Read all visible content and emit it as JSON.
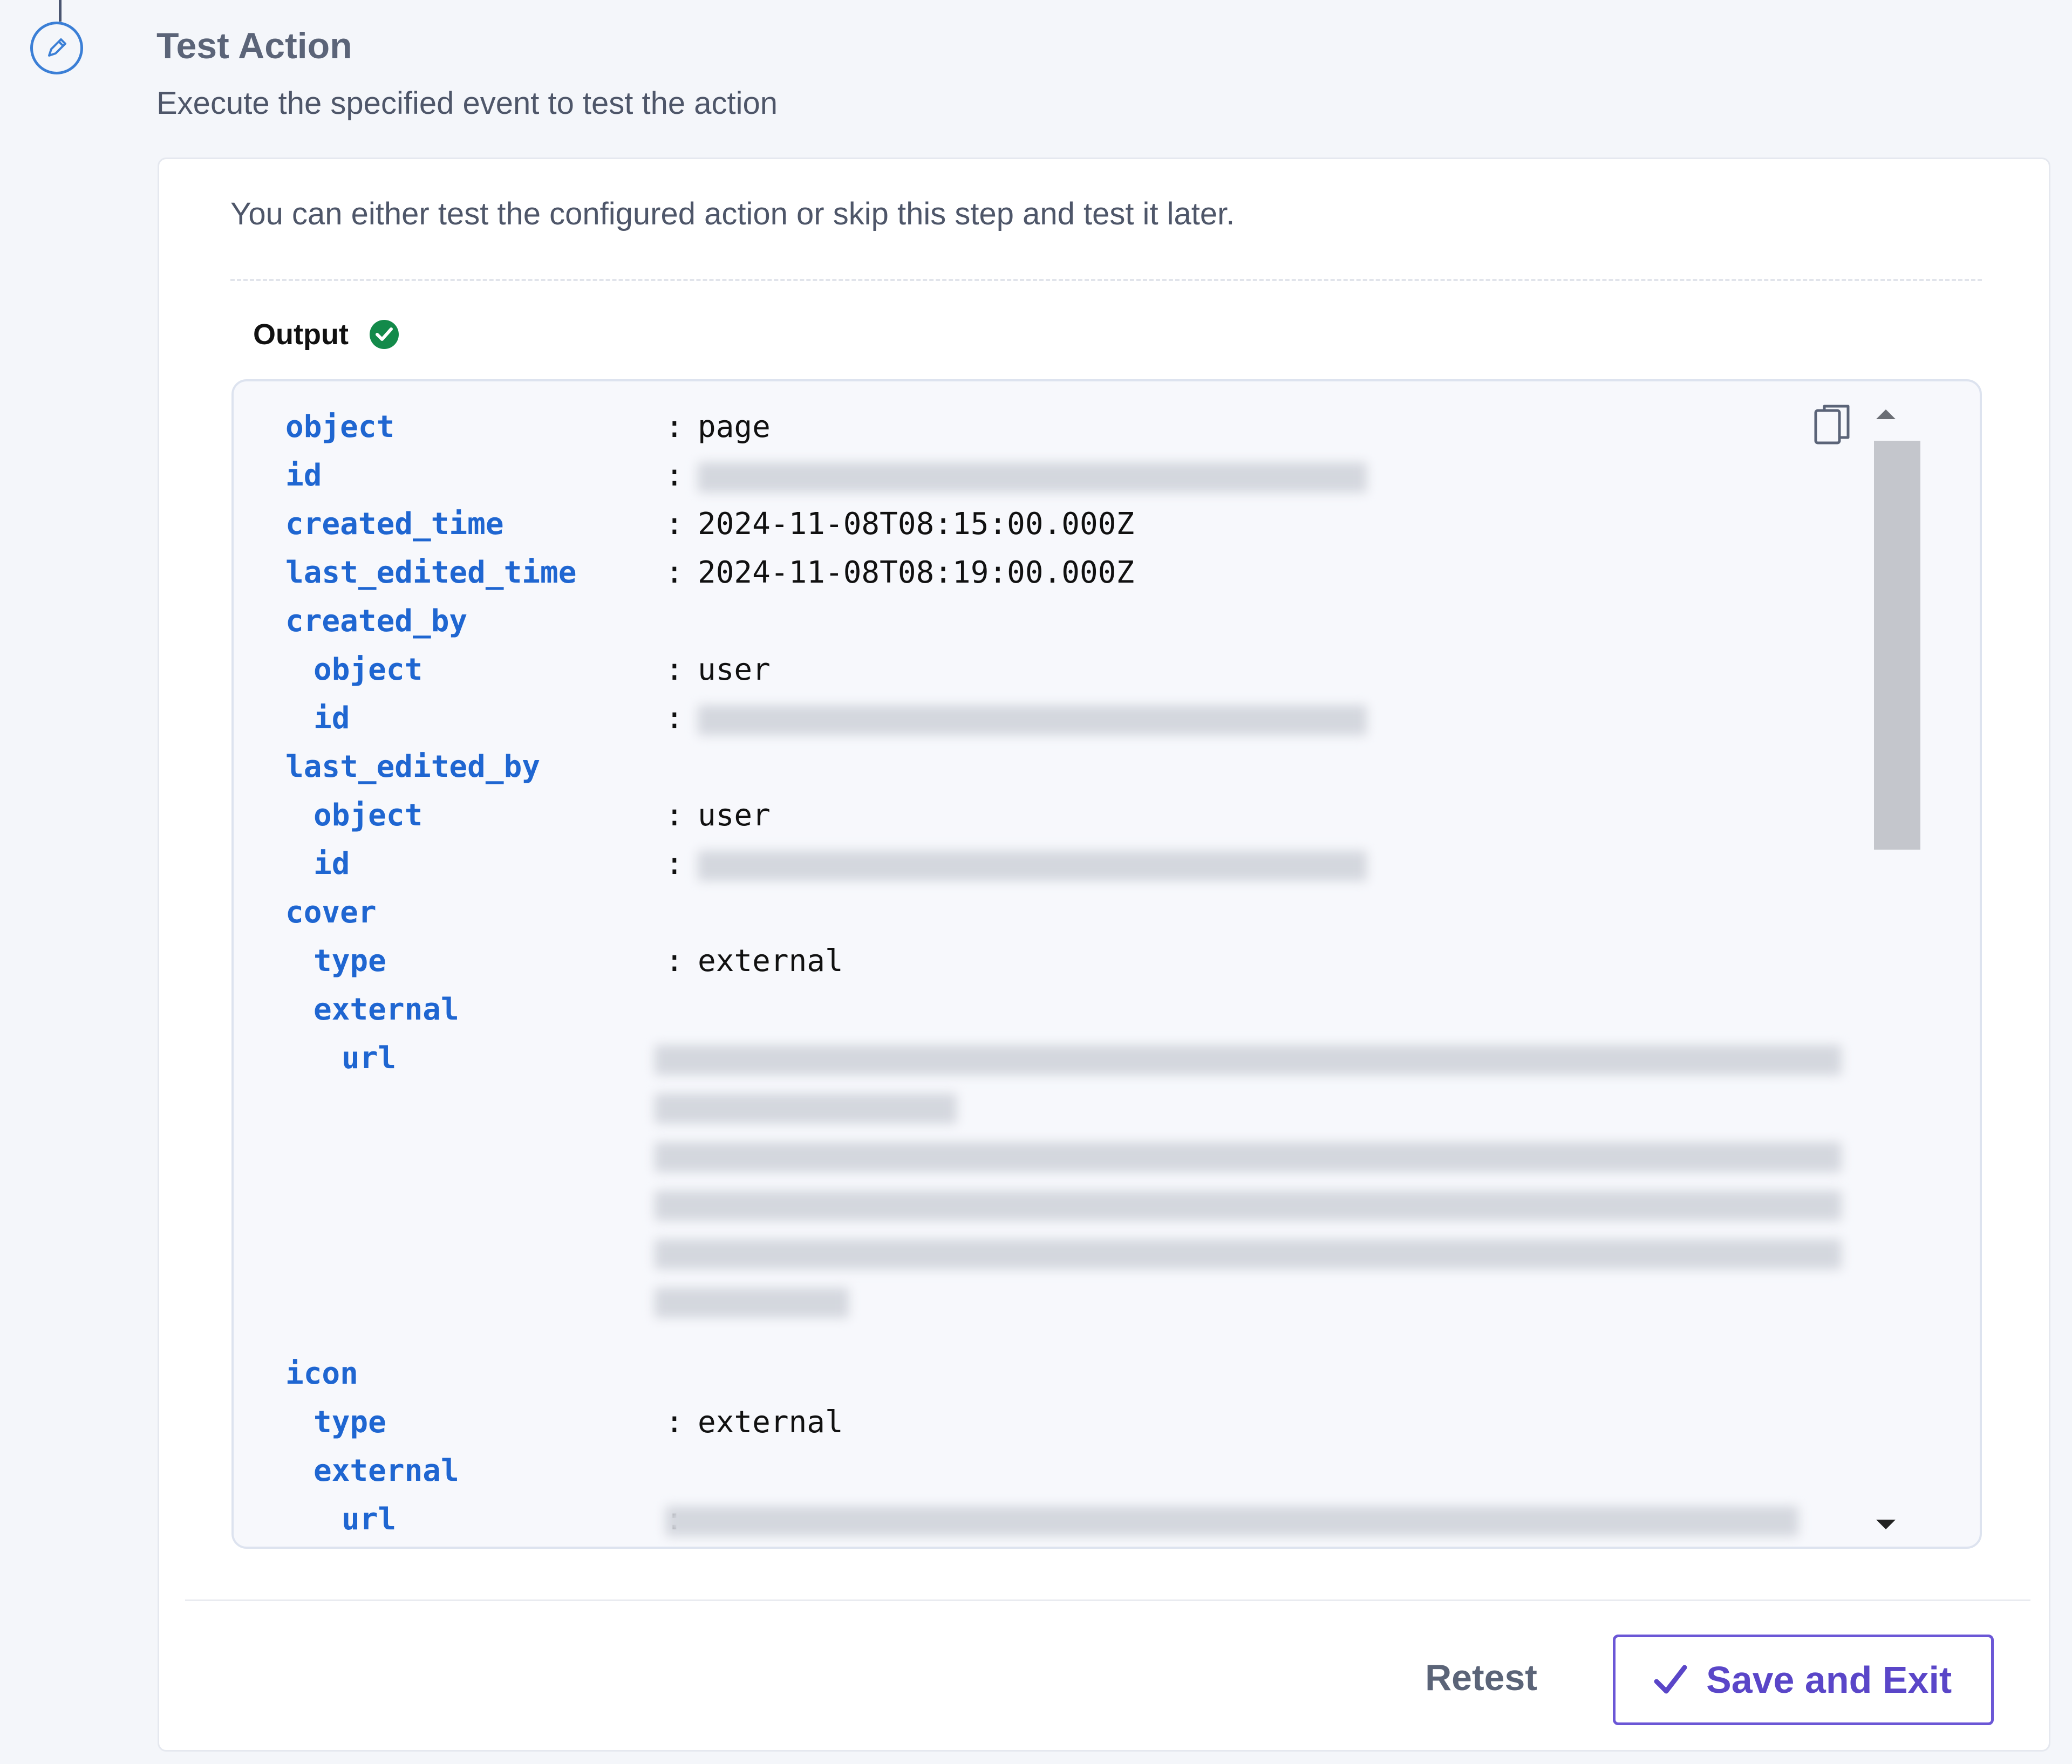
{
  "step": {
    "title": "Test Action",
    "subtitle": "Execute the specified event to test the action",
    "icon": "pencil-icon"
  },
  "card": {
    "intro": "You can either test the configured action or skip this step and test it later.",
    "output_label": "Output",
    "output_status": "success"
  },
  "output": {
    "separator": ":",
    "rows": [
      {
        "key": "object",
        "value": "page",
        "depth": 0,
        "redacted": false
      },
      {
        "key": "id",
        "value": "",
        "depth": 0,
        "redacted": true
      },
      {
        "key": "created_time",
        "value": "2024-11-08T08:15:00.000Z",
        "depth": 0,
        "redacted": false
      },
      {
        "key": "last_edited_time",
        "value": "2024-11-08T08:19:00.000Z",
        "depth": 0,
        "redacted": false
      },
      {
        "key": "created_by",
        "value": "",
        "depth": 0,
        "redacted": false,
        "group": true
      },
      {
        "key": "object",
        "value": "user",
        "depth": 1,
        "redacted": false
      },
      {
        "key": "id",
        "value": "",
        "depth": 1,
        "redacted": true
      },
      {
        "key": "last_edited_by",
        "value": "",
        "depth": 0,
        "redacted": false,
        "group": true
      },
      {
        "key": "object",
        "value": "user",
        "depth": 1,
        "redacted": false
      },
      {
        "key": "id",
        "value": "",
        "depth": 1,
        "redacted": true
      },
      {
        "key": "cover",
        "value": "",
        "depth": 0,
        "redacted": false,
        "group": true
      },
      {
        "key": "type",
        "value": "external",
        "depth": 1,
        "redacted": false
      },
      {
        "key": "external",
        "value": "",
        "depth": 1,
        "redacted": false,
        "group": true
      },
      {
        "key": "url",
        "value": "",
        "depth": 2,
        "redacted": true,
        "multiline": true
      },
      {
        "key": "icon",
        "value": "",
        "depth": 0,
        "redacted": false,
        "group": true
      },
      {
        "key": "type",
        "value": "external",
        "depth": 1,
        "redacted": false
      },
      {
        "key": "external",
        "value": "",
        "depth": 1,
        "redacted": false,
        "group": true
      },
      {
        "key": "url",
        "value": "",
        "depth": 2,
        "redacted": true
      }
    ]
  },
  "actions": {
    "retest_label": "Retest",
    "save_label": "Save and Exit"
  },
  "colors": {
    "key": "#1f66d1",
    "accent": "#5a46c8",
    "success": "#138a4a",
    "step_icon": "#3b7fd6"
  }
}
